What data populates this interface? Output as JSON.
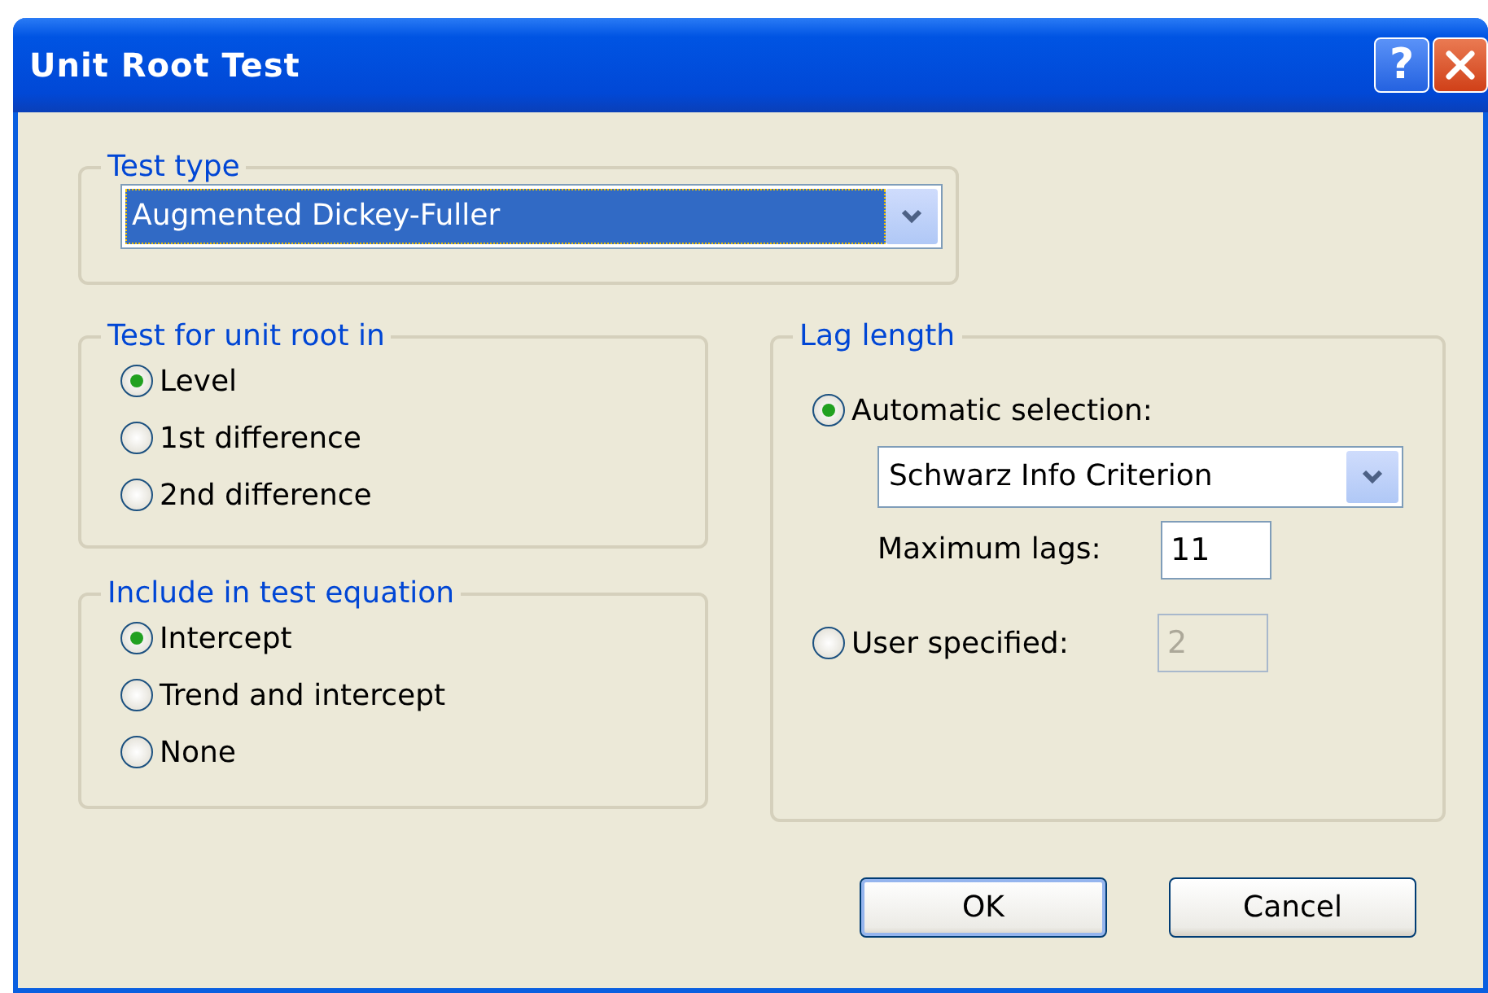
{
  "window": {
    "title": "Unit Root Test",
    "help_button": "?"
  },
  "test_type": {
    "label": "Test type",
    "value": "Augmented Dickey-Fuller",
    "focused": true
  },
  "unit_root": {
    "label": "Test for unit root in",
    "options": [
      {
        "label": "Level",
        "selected": true
      },
      {
        "label": "1st difference",
        "selected": false
      },
      {
        "label": "2nd difference",
        "selected": false
      }
    ]
  },
  "test_equation": {
    "label": "Include in test equation",
    "options": [
      {
        "label": "Intercept",
        "selected": true
      },
      {
        "label": "Trend and intercept",
        "selected": false
      },
      {
        "label": "None",
        "selected": false
      }
    ]
  },
  "lag_length": {
    "label": "Lag length",
    "options": [
      {
        "kind": "auto",
        "label": "Automatic selection:",
        "selected": true
      },
      {
        "kind": "user",
        "label": "User specified:",
        "selected": false
      }
    ],
    "criterion": "Schwarz Info Criterion",
    "max_lags_label": "Maximum lags:",
    "max_lags": "11",
    "user_lags": "2",
    "user_lags_disabled": true
  },
  "buttons": [
    {
      "label": "OK",
      "default": true
    },
    {
      "label": "Cancel",
      "default": false
    }
  ]
}
